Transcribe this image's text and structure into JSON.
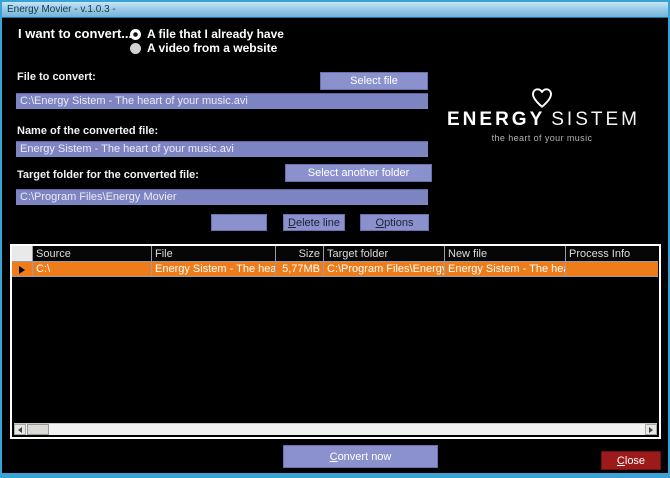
{
  "window": {
    "title": "Energy Movier - v.1.0.3 -"
  },
  "convert": {
    "prompt": "I want to convert...",
    "options": [
      {
        "label": "A file that I already have",
        "selected": true
      },
      {
        "label": "A video from a website",
        "selected": false
      }
    ]
  },
  "file_to_convert": {
    "label": "File to convert:",
    "value": "C:\\Energy Sistem - The heart of your music.avi",
    "button_label": "Select file"
  },
  "converted_name": {
    "label": "Name of the converted file:",
    "value": "Energy Sistem - The heart of your music.avi"
  },
  "target_folder": {
    "label": "Target folder for the converted file:",
    "value": "C:\\Program Files\\Energy Movier",
    "button_label": "Select another folder"
  },
  "actions": {
    "blank_label": "",
    "delete_line_label": "Delete line",
    "options_label": "Options"
  },
  "logo": {
    "heart_icon": "heart-outline",
    "brand_bold": "ENERGY",
    "brand_light": "SISTEM",
    "tagline": "the heart of your music"
  },
  "table": {
    "columns": [
      "",
      "Source",
      "File",
      "Size",
      "Target folder",
      "New file",
      "Process Info"
    ],
    "rows": [
      {
        "source": "C:\\",
        "file": "Energy Sistem - The heart of your music.avi",
        "size": "5,77MB",
        "target_folder": "C:\\Program Files\\Energy Movier",
        "new_file": "Energy Sistem - The heart of your music.avi",
        "process_info": ""
      }
    ]
  },
  "footer": {
    "convert_label": "Convert now",
    "close_label": "Close"
  },
  "colors": {
    "accent_button": "#8a91cd",
    "field": "#7d84c2",
    "selection_orange": "#ee7c1b",
    "close_red": "#9c1a1a",
    "frame_blue": "#3aa2d4",
    "background": "#000000"
  }
}
